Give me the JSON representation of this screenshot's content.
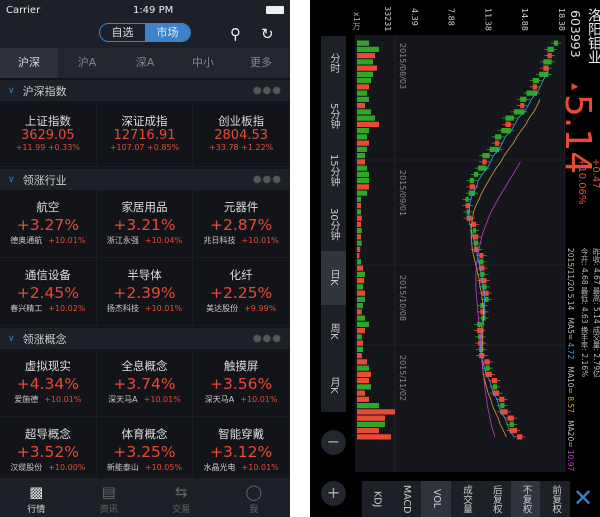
{
  "status": {
    "carrier": "Carrier",
    "time": "1:49 PM"
  },
  "nav": {
    "seg": [
      "自选",
      "市场"
    ],
    "active": 1,
    "search_icon": "search-icon",
    "refresh_icon": "refresh-icon"
  },
  "market_tabs": [
    "沪深",
    "沪A",
    "深A",
    "中小",
    "更多"
  ],
  "sections": [
    {
      "title": "沪深指数",
      "items": [
        {
          "name": "上证指数",
          "value": "3629.05",
          "sub": "+11.99  +0.33%"
        },
        {
          "name": "深证成指",
          "value": "12716.91",
          "sub": "+107.07  +0.85%"
        },
        {
          "name": "创业板指",
          "value": "2804.53",
          "sub": "+33.78  +1.22%"
        }
      ]
    },
    {
      "title": "领涨行业",
      "items": [
        {
          "name": "航空",
          "value": "+3.27%",
          "stock": "德奥通航",
          "sub": "+10.01%"
        },
        {
          "name": "家居用品",
          "value": "+3.21%",
          "stock": "浙江永强",
          "sub": "+10.04%"
        },
        {
          "name": "元器件",
          "value": "+2.87%",
          "stock": "兆日科技",
          "sub": "+10.01%"
        },
        {
          "name": "通信设备",
          "value": "+2.45%",
          "stock": "春兴精工",
          "sub": "+10.02%"
        },
        {
          "name": "半导体",
          "value": "+2.39%",
          "stock": "扬杰科技",
          "sub": "+10.01%"
        },
        {
          "name": "化纤",
          "value": "+2.25%",
          "stock": "美达股份",
          "sub": "+9.99%"
        }
      ]
    },
    {
      "title": "领涨概念",
      "items": [
        {
          "name": "虚拟现实",
          "value": "+4.34%",
          "stock": "爱施德",
          "sub": "+10.01%"
        },
        {
          "name": "全息概念",
          "value": "+3.74%",
          "stock": "深天马A",
          "sub": "+10.01%"
        },
        {
          "name": "触摸屏",
          "value": "+3.56%",
          "stock": "深天马A",
          "sub": "+10.01%"
        },
        {
          "name": "超导概念",
          "value": "+3.52%",
          "stock": "汉缆股份",
          "sub": "+10.00%"
        },
        {
          "name": "体育概念",
          "value": "+3.25%",
          "stock": "新能泰山",
          "sub": "+10.05%"
        },
        {
          "name": "智能穿戴",
          "value": "+3.12%",
          "stock": "水晶光电",
          "sub": "+10.01%"
        }
      ]
    }
  ],
  "tabbar": [
    {
      "label": "行情",
      "icon": "chart-icon"
    },
    {
      "label": "资讯",
      "icon": "news-icon"
    },
    {
      "label": "交易",
      "icon": "trade-icon"
    },
    {
      "label": "我",
      "icon": "user-icon"
    }
  ],
  "stock": {
    "name": "洛阳钼业",
    "code": "603993",
    "price": "5.14",
    "change": "+0.47",
    "pct": "+10.06%",
    "line1": "昨收: 4.67   最高: 5.14   成交量: 2.79亿",
    "line2": "今开: 4.68   最低: 4.63   换手率: 2.16%",
    "date": "2015/11/20   5.14",
    "ma5": "4.72",
    "ma10": "8.57",
    "ma20": "10.97"
  },
  "periods": [
    "分时",
    "5分钟",
    "15分钟",
    "30分钟",
    "日K",
    "周K",
    "月K"
  ],
  "period_active": 4,
  "indicator_tabs": [
    "KDJ",
    "MACD",
    "VOL",
    "成交量",
    "后复权",
    "不复权",
    "前复权"
  ],
  "indicator_active": [
    2,
    5
  ],
  "axis": {
    "vol_unit": "x1万",
    "vol_max": "33231",
    "prices": [
      "4.39",
      "7.88",
      "11.38",
      "14.88",
      "18.38"
    ],
    "dates": [
      "2015/08/03",
      "2015/09/01",
      "2015/10/08",
      "2015/11/02"
    ]
  },
  "colors": {
    "up": "#e84a35",
    "down": "#2fa52a",
    "accent": "#3b82c8"
  },
  "chart_data": {
    "type": "candlestick",
    "price_range": [
      4.39,
      18.38
    ],
    "closes": [
      17.6,
      17.0,
      17.4,
      16.6,
      17.1,
      16.2,
      15.6,
      16.0,
      15.0,
      14.4,
      14.8,
      13.8,
      13.0,
      13.5,
      12.6,
      12.0,
      12.4,
      11.5,
      10.8,
      11.2,
      10.4,
      10.0,
      9.6,
      10.1,
      9.5,
      9.2,
      9.6,
      9.3,
      9.8,
      10.2,
      9.9,
      10.4,
      10.0,
      10.5,
      10.9,
      10.5,
      11.0,
      10.6,
      11.2,
      10.8,
      11.4,
      11.0,
      10.6,
      11.1,
      10.7,
      10.3,
      10.8,
      10.4,
      10.9,
      10.5,
      11.0,
      11.5,
      11.1,
      11.7,
      12.2,
      11.8,
      12.4,
      12.9,
      12.5,
      13.2,
      13.8,
      13.4,
      14.1,
      14.6
    ],
    "volumes": [
      0.3,
      0.55,
      0.45,
      0.4,
      0.5,
      0.4,
      0.35,
      0.3,
      0.25,
      0.3,
      0.2,
      0.35,
      0.45,
      0.55,
      0.3,
      0.25,
      0.3,
      0.25,
      0.2,
      0.2,
      0.25,
      0.3,
      0.3,
      0.3,
      0.25,
      0.1,
      0.1,
      0.1,
      0.12,
      0.1,
      0.12,
      0.1,
      0.12,
      0.08,
      0.06,
      0.1,
      0.15,
      0.2,
      0.18,
      0.15,
      0.2,
      0.2,
      0.15,
      0.12,
      0.2,
      0.3,
      0.2,
      0.12,
      0.15,
      0.15,
      0.12,
      0.25,
      0.3,
      0.35,
      0.3,
      0.35,
      0.2,
      0.3,
      0.55,
      0.95,
      0.7,
      0.7,
      0.55,
      0.85
    ]
  }
}
